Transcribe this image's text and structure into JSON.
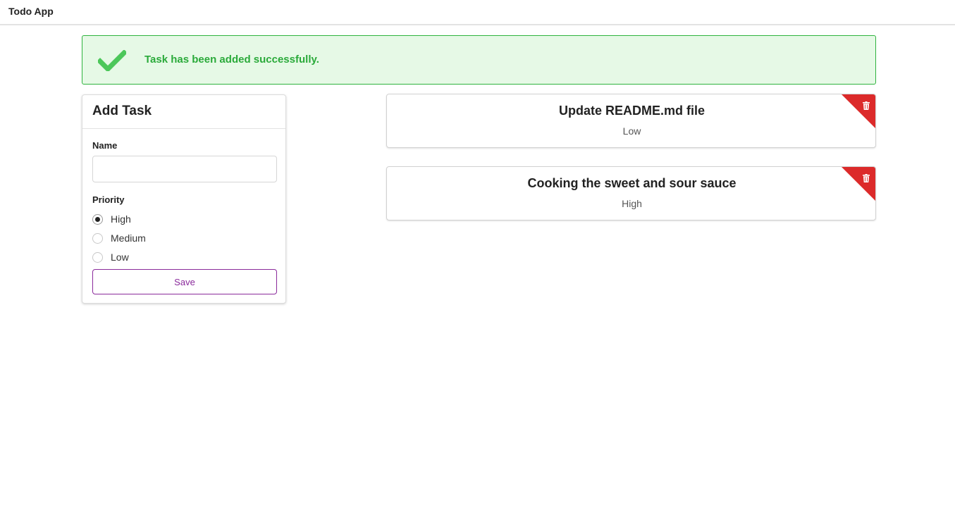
{
  "app": {
    "title": "Todo App"
  },
  "alert": {
    "message": "Task has been added successfully.",
    "icon": "check-icon"
  },
  "form": {
    "title": "Add Task",
    "name_label": "Name",
    "name_value": "",
    "priority_label": "Priority",
    "options": [
      {
        "label": "High",
        "checked": true
      },
      {
        "label": "Medium",
        "checked": false
      },
      {
        "label": "Low",
        "checked": false
      }
    ],
    "save_label": "Save"
  },
  "tasks": [
    {
      "name": "Update README.md file",
      "priority": "Low"
    },
    {
      "name": "Cooking the sweet and sour sauce",
      "priority": "High"
    }
  ],
  "colors": {
    "accent": "#8a2a9b",
    "success": "#2aaa3a",
    "danger": "#dc2a2a"
  }
}
